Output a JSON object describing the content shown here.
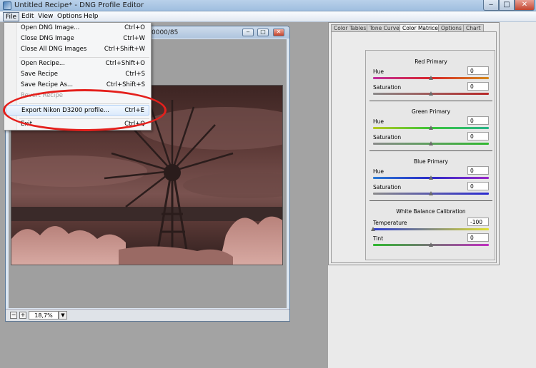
{
  "window": {
    "title": "Untitled Recipe* - DNG Profile Editor"
  },
  "menubar": {
    "items": [
      "File",
      "Edit",
      "View",
      "Options",
      "Help"
    ]
  },
  "file_menu": {
    "items": [
      {
        "label": "Open DNG Image...",
        "shortcut": "Ctrl+O",
        "disabled": false
      },
      {
        "label": "Close DNG Image",
        "shortcut": "Ctrl+W",
        "disabled": false
      },
      {
        "label": "Close All DNG Images",
        "shortcut": "Ctrl+Shift+W",
        "disabled": false
      },
      {
        "label": "Open Recipe...",
        "shortcut": "Ctrl+Shift+O",
        "disabled": false
      },
      {
        "label": "Save Recipe",
        "shortcut": "Ctrl+S",
        "disabled": false
      },
      {
        "label": "Save Recipe As...",
        "shortcut": "Ctrl+Shift+S",
        "disabled": false
      },
      {
        "label": "Revert Recipe",
        "shortcut": "",
        "disabled": true
      },
      {
        "label": "Export Nikon D3200 profile...",
        "shortcut": "Ctrl+E",
        "disabled": false,
        "highlighted": true
      },
      {
        "label": "Exit",
        "shortcut": "Ctrl+Q",
        "disabled": false
      }
    ]
  },
  "image_window": {
    "title_fragment": "0000/85",
    "zoom_value": "18,7%",
    "zoom_minus": "−",
    "zoom_plus": "+"
  },
  "panel": {
    "tabs": [
      {
        "label": "Color Tables",
        "active": false
      },
      {
        "label": "Tone Curve",
        "active": false
      },
      {
        "label": "Color Matrices",
        "active": true
      },
      {
        "label": "Options",
        "active": false
      },
      {
        "label": "Chart",
        "active": false
      }
    ],
    "sections": [
      {
        "title": "Red Primary",
        "rows": [
          {
            "label": "Hue",
            "value": "0",
            "level": 0.5
          },
          {
            "label": "Saturation",
            "value": "0",
            "level": 0.5
          }
        ]
      },
      {
        "title": "Green Primary",
        "rows": [
          {
            "label": "Hue",
            "value": "0",
            "level": 0.5
          },
          {
            "label": "Saturation",
            "value": "0",
            "level": 0.5
          }
        ]
      },
      {
        "title": "Blue Primary",
        "rows": [
          {
            "label": "Hue",
            "value": "0",
            "level": 0.5
          },
          {
            "label": "Saturation",
            "value": "0",
            "level": 0.5
          }
        ]
      },
      {
        "title": "White Balance Calibration",
        "rows": [
          {
            "label": "Temperature",
            "value": "-100",
            "level": 0.0
          },
          {
            "label": "Tint",
            "value": "0",
            "level": 0.5
          }
        ]
      }
    ]
  },
  "colors": {
    "annotation": "#e4201c",
    "photo_tint": "#6b4643"
  }
}
